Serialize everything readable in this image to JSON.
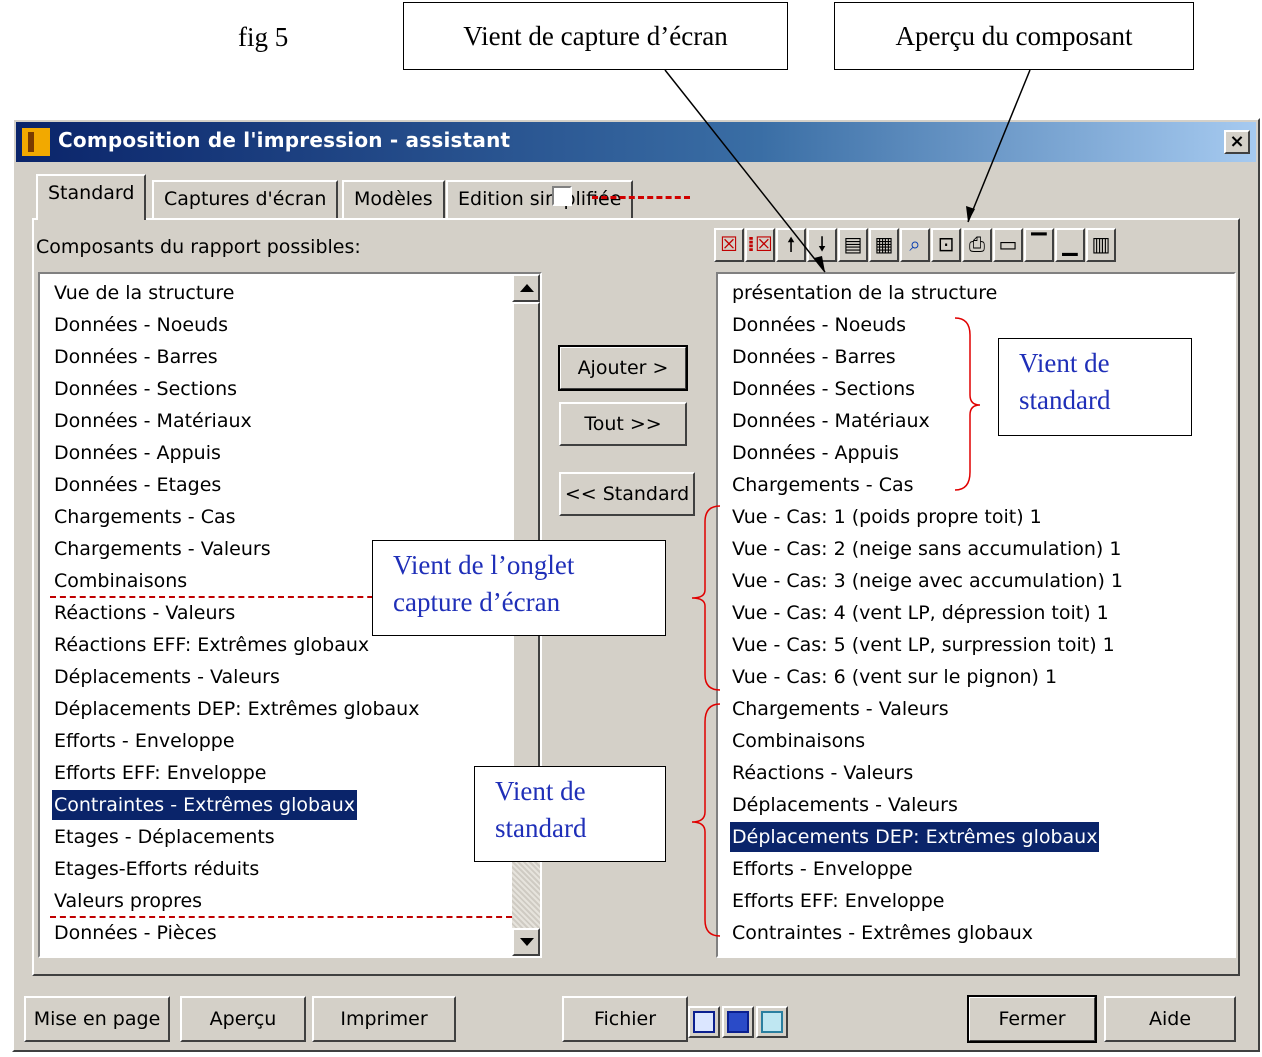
{
  "figure": {
    "label": "fig 5",
    "callouts": {
      "capture": "Vient de capture d’écran",
      "apercu": "Aperçu du composant"
    }
  },
  "window": {
    "title": "Composition de l'impression - assistant",
    "close_label": "×"
  },
  "tabs": [
    {
      "label": "Standard"
    },
    {
      "label": "Captures d'écran"
    },
    {
      "label": "Modèles"
    },
    {
      "label": "Edition simplifiée"
    }
  ],
  "left_panel": {
    "label": "Composants du rapport possibles:",
    "items": [
      "Vue de la structure",
      "Données - Noeuds",
      "Données - Barres",
      "Données - Sections",
      "Données - Matériaux",
      "Données - Appuis",
      "Données - Etages",
      "Chargements - Cas",
      "Chargements - Valeurs",
      "Combinaisons",
      "Réactions - Valeurs",
      "Réactions EFF: Extrêmes globaux",
      "Déplacements - Valeurs",
      "Déplacements DEP: Extrêmes globaux",
      "Efforts - Enveloppe",
      "Efforts EFF: Enveloppe",
      "Contraintes - Extrêmes globaux",
      "Etages - Déplacements",
      "Etages-Efforts réduits",
      "Valeurs propres",
      "Données - Pièces"
    ],
    "selected": "Contraintes - Extrêmes globaux"
  },
  "middle": {
    "add_label": "Ajouter >",
    "all_label": "Tout >>",
    "standard_label": "<< Standard"
  },
  "right_panel": {
    "items": [
      "présentation de la structure",
      "Données - Noeuds",
      "Données - Barres",
      "Données - Sections",
      "Données - Matériaux",
      "Données - Appuis",
      "Chargements - Cas",
      "Vue - Cas: 1 (poids propre toit) 1",
      "Vue - Cas: 2 (neige sans accumulation) 1",
      "Vue - Cas: 3 (neige avec accumulation) 1",
      "Vue - Cas: 4 (vent LP, dépression toit) 1",
      "Vue - Cas: 5 (vent LP, surpression toit) 1",
      "Vue - Cas: 6 (vent sur le pignon) 1",
      "Chargements - Valeurs",
      "Combinaisons",
      "Réactions - Valeurs",
      "Déplacements - Valeurs",
      "Déplacements DEP: Extrêmes globaux",
      "Efforts - Enveloppe",
      "Efforts EFF: Enveloppe",
      "Contraintes - Extrêmes globaux"
    ],
    "selected": "Déplacements DEP: Extrêmes globaux"
  },
  "annotations": {
    "standard_top_line1": "Vient de",
    "standard_top_line2": "standard",
    "onglet_line1": "Vient de l’onglet",
    "onglet_line2": "capture d’écran",
    "standard_bottom_line1": "Vient de",
    "standard_bottom_line2": "standard",
    "text_color": "#1f2fb8"
  },
  "toolbar": {
    "icons": [
      "delete-icon",
      "delete-all-icon",
      "move-up-icon",
      "move-down-icon",
      "format-icon",
      "format-clear-icon",
      "preview-icon",
      "frame-icon",
      "print-icon",
      "edit-icon",
      "page-header-icon",
      "page-footer-icon",
      "table-icon"
    ]
  },
  "footer": {
    "page_setup_label": "Mise en page",
    "preview_label": "Aperçu",
    "print_label": "Imprimer",
    "file_label": "Fichier",
    "close_label": "Fermer",
    "help_label": "Aide"
  },
  "colors": {
    "selection": "#0a246a",
    "title_bar_start": "#0a246a",
    "separator": "#c00000",
    "face": "#d4d0c8"
  }
}
